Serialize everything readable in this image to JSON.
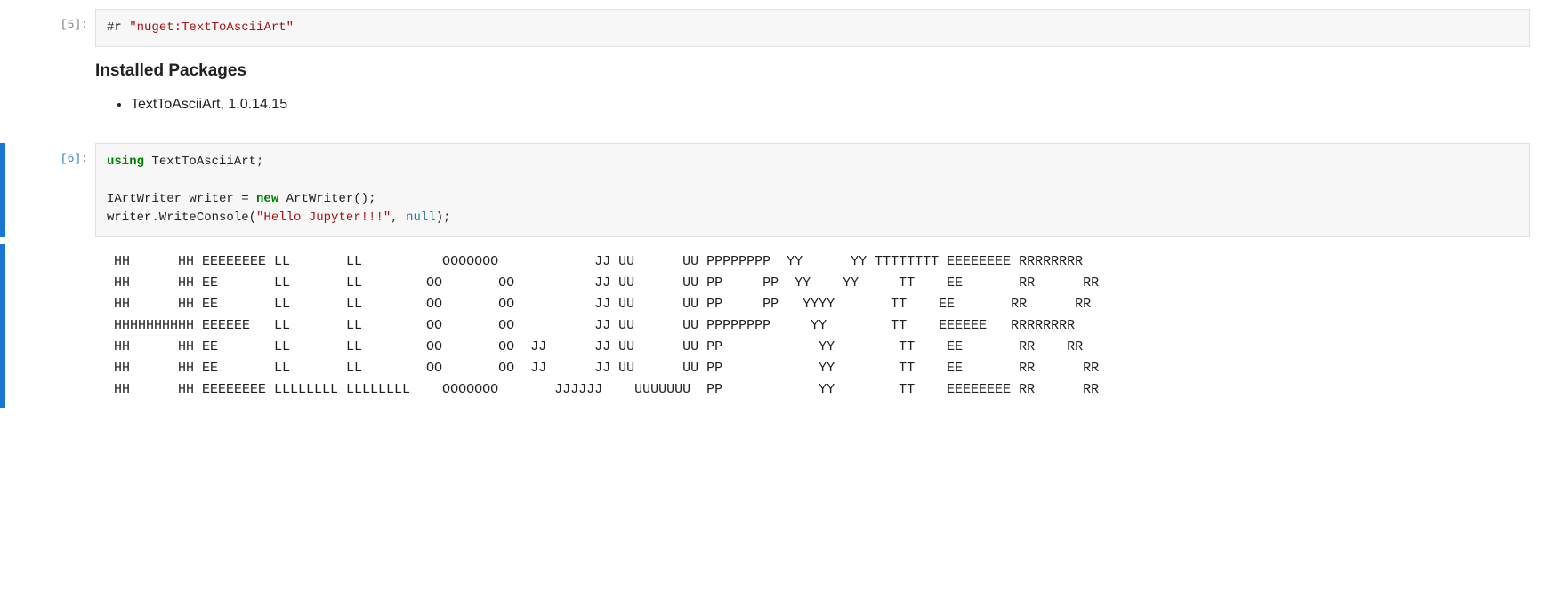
{
  "cells": [
    {
      "prompt": "[5]:",
      "code_tokens": [
        {
          "t": "#r ",
          "c": "tk-meta"
        },
        {
          "t": "\"nuget:TextToAsciiArt\"",
          "c": "tk-str"
        }
      ],
      "output": {
        "heading": "Installed Packages",
        "packages": [
          "TextToAsciiArt, 1.0.14.15"
        ]
      }
    },
    {
      "prompt": "[6]:",
      "code_tokens": [
        {
          "t": "using",
          "c": "tk-kw"
        },
        {
          "t": " TextToAsciiArt;\n\nIArtWriter writer = ",
          "c": "tk-name"
        },
        {
          "t": "new",
          "c": "tk-kw"
        },
        {
          "t": " ArtWriter();\nwriter.WriteConsole(",
          "c": "tk-name"
        },
        {
          "t": "\"Hello Jupyter!!!\"",
          "c": "tk-str"
        },
        {
          "t": ", ",
          "c": "tk-name"
        },
        {
          "t": "null",
          "c": "tk-null"
        },
        {
          "t": ");",
          "c": "tk-name"
        }
      ],
      "ascii_output": " HH      HH EEEEEEEE LL       LL          OOOOOOO            JJ UU      UU PPPPPPPP  YY      YY TTTTTTTT EEEEEEEE RRRRRRRR \n HH      HH EE       LL       LL        OO       OO          JJ UU      UU PP     PP  YY    YY     TT    EE       RR      RR \n HH      HH EE       LL       LL        OO       OO          JJ UU      UU PP     PP   YYYY       TT    EE       RR      RR \n HHHHHHHHHH EEEEEE   LL       LL        OO       OO          JJ UU      UU PPPPPPPP     YY        TT    EEEEEE   RRRRRRRR \n HH      HH EE       LL       LL        OO       OO  JJ      JJ UU      UU PP            YY        TT    EE       RR    RR   \n HH      HH EE       LL       LL        OO       OO  JJ      JJ UU      UU PP            YY        TT    EE       RR      RR \n HH      HH EEEEEEEE LLLLLLLL LLLLLLLL    OOOOOOO       JJJJJJ    UUUUUUU  PP            YY        TT    EEEEEEEE RR      RR"
    }
  ]
}
